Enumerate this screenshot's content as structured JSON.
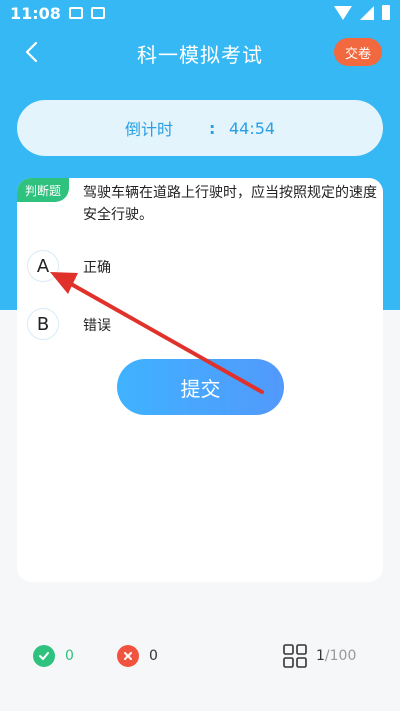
{
  "status_bar": {
    "time": "11:08"
  },
  "header": {
    "title": "科一模拟考试",
    "submit_paper_label": "交卷"
  },
  "timer": {
    "label": "倒计时",
    "separator": ":",
    "value": "44:54"
  },
  "question": {
    "type_badge": "判断题",
    "text": "驾驶车辆在道路上行驶时，应当按照规定的速度安全行驶。",
    "options": [
      {
        "letter": "A",
        "text": "正确"
      },
      {
        "letter": "B",
        "text": "错误"
      }
    ],
    "submit_label": "提交"
  },
  "footer": {
    "correct_count": "0",
    "wrong_count": "0",
    "current": "1",
    "total": "/100"
  },
  "colors": {
    "primary": "#35b8f3",
    "accent_red": "#f2683f",
    "green": "#2fc27f",
    "annotation_arrow": "#e0322b"
  },
  "icons": {
    "back": "chevron-left-icon",
    "correct": "check-circle-icon",
    "wrong": "x-circle-icon",
    "grid": "grid-icon"
  }
}
